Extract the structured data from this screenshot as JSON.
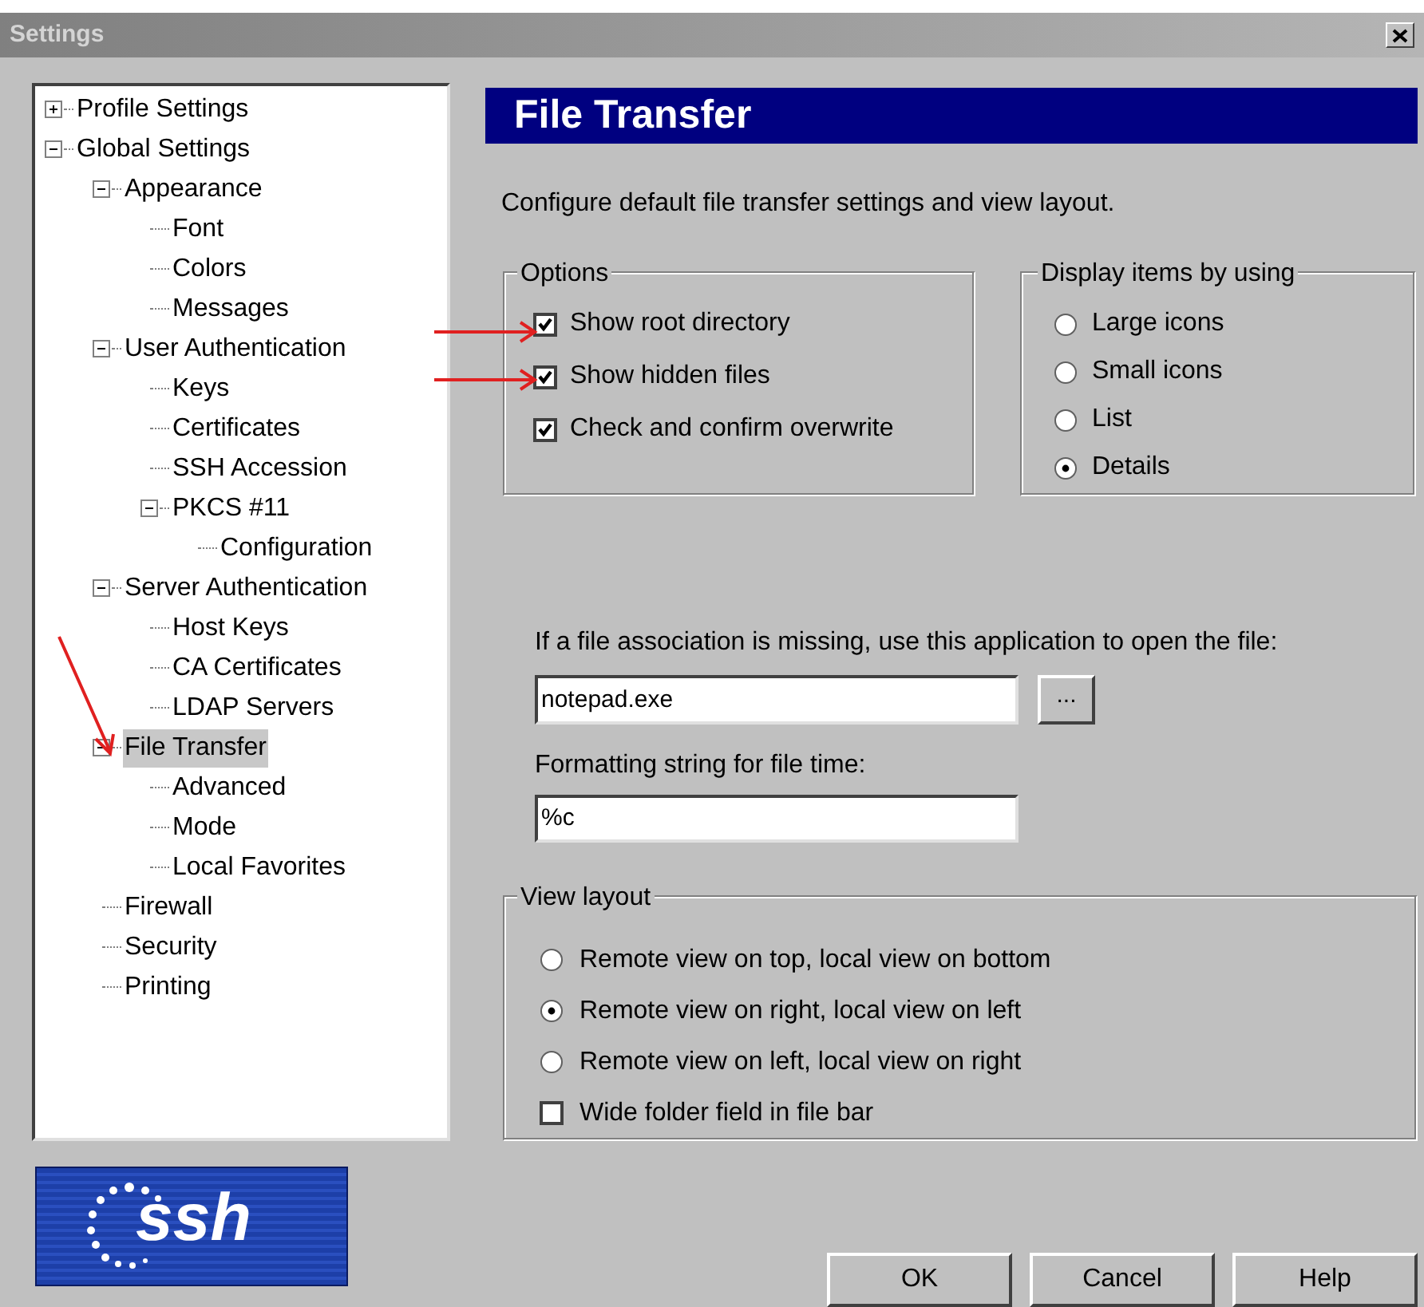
{
  "window": {
    "title": "Settings"
  },
  "tree": [
    {
      "label": "Profile Settings",
      "expanded": false,
      "selected": false
    },
    {
      "label": "Global Settings",
      "expanded": true,
      "selected": false,
      "children": [
        {
          "label": "Appearance",
          "expanded": true,
          "selected": false,
          "children": [
            {
              "label": "Font",
              "selected": false
            },
            {
              "label": "Colors",
              "selected": false
            },
            {
              "label": "Messages",
              "selected": false
            }
          ]
        },
        {
          "label": "User Authentication",
          "expanded": true,
          "selected": false,
          "children": [
            {
              "label": "Keys",
              "selected": false
            },
            {
              "label": "Certificates",
              "selected": false
            },
            {
              "label": "SSH Accession",
              "selected": false
            },
            {
              "label": "PKCS #11",
              "expanded": true,
              "selected": false,
              "children": [
                {
                  "label": "Configuration",
                  "selected": false
                }
              ]
            }
          ]
        },
        {
          "label": "Server Authentication",
          "expanded": true,
          "selected": false,
          "children": [
            {
              "label": "Host Keys",
              "selected": false
            },
            {
              "label": "CA Certificates",
              "selected": false
            },
            {
              "label": "LDAP Servers",
              "selected": false
            }
          ]
        },
        {
          "label": "File Transfer",
          "expanded": true,
          "selected": true,
          "children": [
            {
              "label": "Advanced",
              "selected": false
            },
            {
              "label": "Mode",
              "selected": false
            },
            {
              "label": "Local Favorites",
              "selected": false
            }
          ]
        },
        {
          "label": "Firewall",
          "selected": false
        },
        {
          "label": "Security",
          "selected": false
        },
        {
          "label": "Printing",
          "selected": false
        }
      ]
    }
  ],
  "logo": {
    "text": "ssh"
  },
  "page": {
    "heading": "File Transfer",
    "description": "Configure default file transfer settings and view layout."
  },
  "options": {
    "title": "Options",
    "items": [
      {
        "label": "Show root directory",
        "checked": true
      },
      {
        "label": "Show hidden files",
        "checked": true
      },
      {
        "label": "Check and confirm overwrite",
        "checked": true
      }
    ]
  },
  "display": {
    "title": "Display items by using",
    "items": [
      {
        "label": "Large icons",
        "selected": false
      },
      {
        "label": "Small icons",
        "selected": false
      },
      {
        "label": "List",
        "selected": false
      },
      {
        "label": "Details",
        "selected": true
      }
    ]
  },
  "association": {
    "label": "If a file association is missing, use this application to open the file:",
    "value": "notepad.exe",
    "browse": "..."
  },
  "time_format": {
    "label": "Formatting string for file time:",
    "value": "%c"
  },
  "view_layout": {
    "title": "View layout",
    "items": [
      {
        "kind": "radio",
        "label": "Remote view on top, local view on bottom",
        "selected": false
      },
      {
        "kind": "radio",
        "label": "Remote view on right, local view on left",
        "selected": true
      },
      {
        "kind": "radio",
        "label": "Remote view on left, local view on right",
        "selected": false
      },
      {
        "kind": "checkbox",
        "label": "Wide folder field in file bar",
        "checked": false
      }
    ]
  },
  "buttons": [
    "OK",
    "Cancel",
    "Help"
  ]
}
